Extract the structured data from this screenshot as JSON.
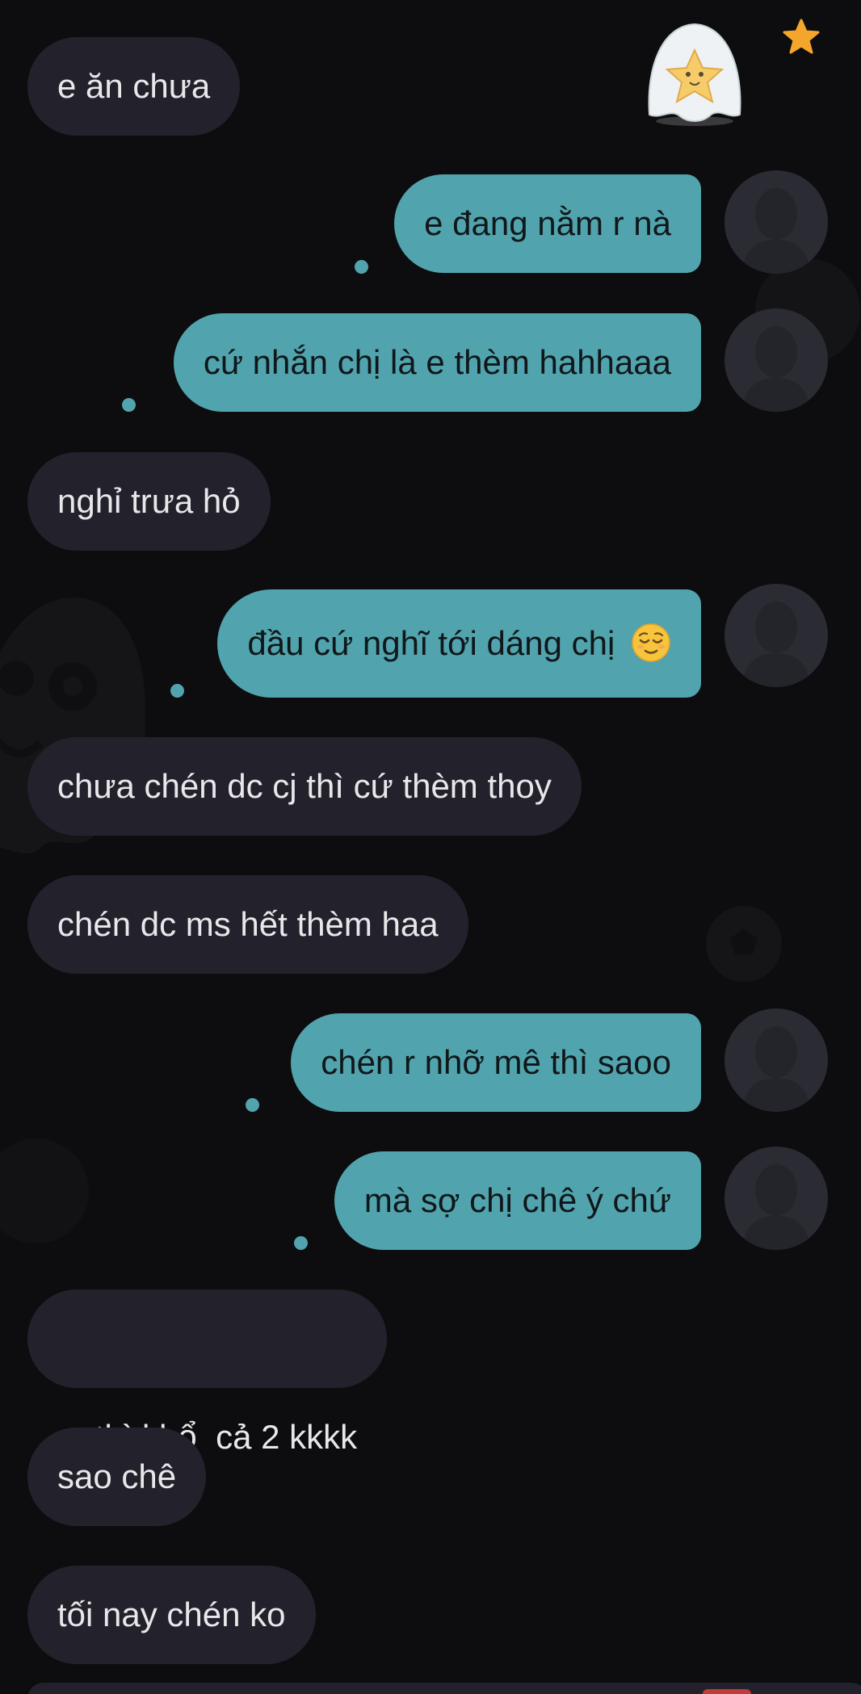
{
  "colors": {
    "background": "#0d0d0f",
    "incoming_bubble": "#23222c",
    "outgoing_bubble": "#51a4ad",
    "avatar_placeholder": "#2b2b33",
    "star": "#f4a52b"
  },
  "icons": {
    "sticker": "ghost-star-sticker-icon",
    "favorite": "star-icon",
    "avatar": "default-avatar-icon",
    "relieved_emoji": "relieved-face-emoji-icon"
  },
  "messages": [
    {
      "direction": "incoming",
      "text": "e ăn chưa"
    },
    {
      "direction": "outgoing",
      "text": "e đang nằm r nà"
    },
    {
      "direction": "outgoing",
      "text": "cứ nhắn chị là e thèm hahhaaa"
    },
    {
      "direction": "incoming",
      "text": "nghỉ trưa hỏ"
    },
    {
      "direction": "outgoing",
      "text": "đầu cứ nghĩ tới dáng chị",
      "emoji": "😌"
    },
    {
      "direction": "incoming",
      "text": "chưa chén dc cj thì cứ thèm thoy"
    },
    {
      "direction": "incoming",
      "text": "chén dc ms hết thèm haa"
    },
    {
      "direction": "outgoing",
      "text": "chén r nhỡ mê thì saoo"
    },
    {
      "direction": "outgoing",
      "text": "mà sợ chị chê ý chứ"
    },
    {
      "direction": "incoming",
      "text": "thì khổ  cả 2 kkkk"
    },
    {
      "direction": "incoming",
      "text": "sao chê"
    },
    {
      "direction": "incoming",
      "text": "tối nay chén ko"
    }
  ]
}
